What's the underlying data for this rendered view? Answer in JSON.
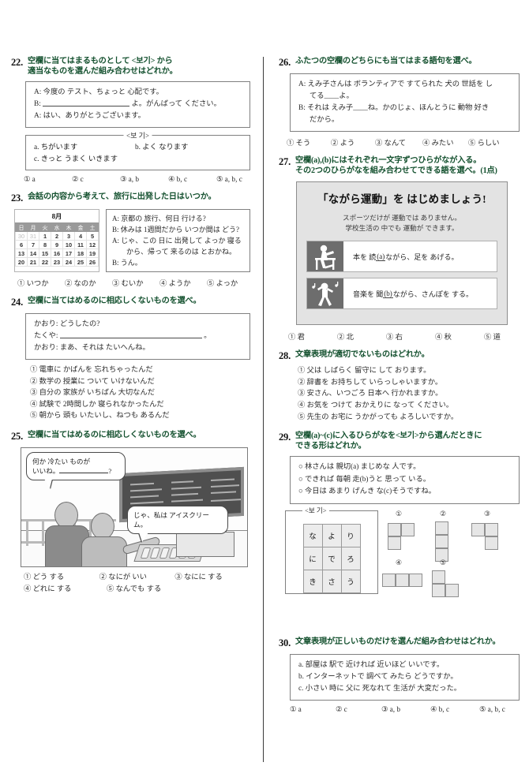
{
  "questions": {
    "q22": {
      "number": "22.",
      "prompt_line1": "空欄に当てはまるものとして <보기> から",
      "prompt_line2": "適当なものを選んだ組み合わせはどれか。",
      "dialogue": [
        {
          "speaker": "A:",
          "text": "今度の テスト、ちょっと 心配です。"
        },
        {
          "speaker": "B:",
          "text": "よ。がんばって ください。",
          "has_blank": true
        },
        {
          "speaker": "A:",
          "text": "はい、ありがとうございます。"
        }
      ],
      "bogi_caption": "<보 기>",
      "bogi_items": [
        "a. ちがいます",
        "b. よく なります",
        "c. きっと うまく いきます"
      ],
      "choices": [
        "① a",
        "② c",
        "③ a, b",
        "④ b, c",
        "⑤ a, b, c"
      ]
    },
    "q23": {
      "number": "23.",
      "prompt_line1": "会話の内容から考えて、旅行に出発した日はいつか。",
      "calendar": {
        "title": "8月",
        "weekdays": [
          "日",
          "月",
          "火",
          "水",
          "木",
          "金",
          "土"
        ],
        "weeks": [
          [
            "30",
            "31",
            "1",
            "2",
            "3",
            "4",
            "5"
          ],
          [
            "6",
            "7",
            "8",
            "9",
            "10",
            "11",
            "12"
          ],
          [
            "13",
            "14",
            "15",
            "16",
            "17",
            "18",
            "19"
          ],
          [
            "20",
            "21",
            "22",
            "23",
            "24",
            "25",
            "26"
          ]
        ],
        "dim_cells": [
          "30",
          "31"
        ]
      },
      "dialogue": [
        {
          "speaker": "A:",
          "text": "京都の 旅行、何日 行ける?"
        },
        {
          "speaker": "B:",
          "text": "休みは 1週間だから いつか間は どう?"
        },
        {
          "speaker": "A:",
          "text": "じゃ、この 日に 出発して よっか 寝る",
          "cont": "から、帰って 来るのは とおかね。"
        },
        {
          "speaker": "B:",
          "text": "うん。"
        }
      ],
      "choices": [
        "① いつか",
        "② なのか",
        "③ むいか",
        "④ ようか",
        "⑤ よっか"
      ]
    },
    "q24": {
      "number": "24.",
      "prompt_line1": "空欄に当てはめるのに相応しくないものを選べ。",
      "dialogue": [
        {
          "speaker": "かおり:",
          "text": "どうしたの?"
        },
        {
          "speaker": "たくや:",
          "text": "。",
          "has_blank": true
        },
        {
          "speaker": "かおり:",
          "text": "まあ、それは たいへんね。"
        }
      ],
      "choices": [
        "① 電車に かばんを 忘れちゃったんだ",
        "② 数学の 授業に ついて いけないんだ",
        "③ 自分の 家族が いちばん 大切なんだ",
        "④ 試験で 2時間しか 寝られなかったんだ",
        "⑤ 朝から 頭も いたいし、ねつも あるんだ"
      ]
    },
    "q25": {
      "number": "25.",
      "prompt_line1": "空欄に当てはめるのに相応しくないものを選べ。",
      "bubble1_line1": "何か 冷たい ものが",
      "bubble1_line2a": "いいね。",
      "bubble1_line2b": "?",
      "bubble2": "じゃ、私は アイスクリーム。",
      "choices": [
        "① どう する",
        "② なにが いい",
        "③ なにに する",
        "④ どれに する",
        "⑤ なんでも する"
      ]
    },
    "q26": {
      "number": "26.",
      "prompt_line1": "ふたつの空欄のどちらにも当てはまる語句を選べ。",
      "dialogue_lines": [
        "A: えみ子さんは ボランティアで すてられた 犬の 世話を し",
        "てる____よ。",
        "B: それは えみ子____ね。かのじょ、ほんとうに 動物 好き",
        "だから。"
      ],
      "choices": [
        "① そう",
        "② よう",
        "③ なんて",
        "④ みたい",
        "⑤ らしい"
      ]
    },
    "q27": {
      "number": "27.",
      "prompt_line1": "空欄(a),(b)にはそれぞれ一文字ずつひらがなが入る。",
      "prompt_line2": "その2つのひらがなを組み合わせてできる語を選べ。(1点)",
      "poster": {
        "title": "「ながら運動」を はじめましょう!",
        "sub_line1": "スポーツだけが 運動では ありません。",
        "sub_line2": "学校生活の 中でも 運動が できます。",
        "items": [
          {
            "icon": "person-reading-at-desk-icon",
            "text_pre": "本を 読",
            "blank": "(a)",
            "text_post": "ながら、足を あげる。"
          },
          {
            "icon": "person-walking-with-music-icon",
            "text_pre": "音楽を 聞",
            "blank": "(b)",
            "text_post": "ながら、さんぽを する。"
          }
        ]
      },
      "choices": [
        "① 君",
        "② 北",
        "③ 右",
        "④ 秋",
        "⑤ 道"
      ]
    },
    "q28": {
      "number": "28.",
      "prompt_line1": "文章表現が適切でないものはどれか。",
      "choices": [
        "① 父は しばらく 留守に して おります。",
        "② 辞書を お持ちして いらっしゃいますか。",
        "③ 安さん、いつごろ 日本へ 行かれますか。",
        "④ お気を つけて おかえりに なって ください。",
        "⑤ 先生の お宅に うかがっても よろしいですか。"
      ]
    },
    "q29": {
      "number": "29.",
      "prompt_line1": "空欄(a)~(c)に入るひらがなを<보기>から選んだときに",
      "prompt_line2": "できる形はどれか。",
      "sentences": [
        "○ 林さんは 親切(a) まじめな 人です。",
        "○ できれば 毎朝 走(b)うと 思って いる。",
        "○ 今日は あまり げんき な(c)そうですね。"
      ],
      "bogi_caption": "<보 기>",
      "kana_grid": [
        [
          "な",
          "よ",
          "り"
        ],
        [
          "に",
          "で",
          "ろ"
        ],
        [
          "き",
          "さ",
          "う"
        ]
      ],
      "shape_labels": [
        "①",
        "②",
        "③",
        "④",
        "⑤"
      ]
    },
    "q30": {
      "number": "30.",
      "prompt_line1": "文章表現が正しいものだけを選んだ組み合わせはどれか。",
      "items": [
        "a. 部屋は 駅で 近ければ 近いほど いいです。",
        "b. インターネットで 調べて みたら どうですか。",
        "c. 小さい 時に 父に 死なれて 生活が 大変だった。"
      ],
      "choices": [
        "① a",
        "② c",
        "③ a, b",
        "④ b, c",
        "⑤ a, b, c"
      ]
    }
  }
}
